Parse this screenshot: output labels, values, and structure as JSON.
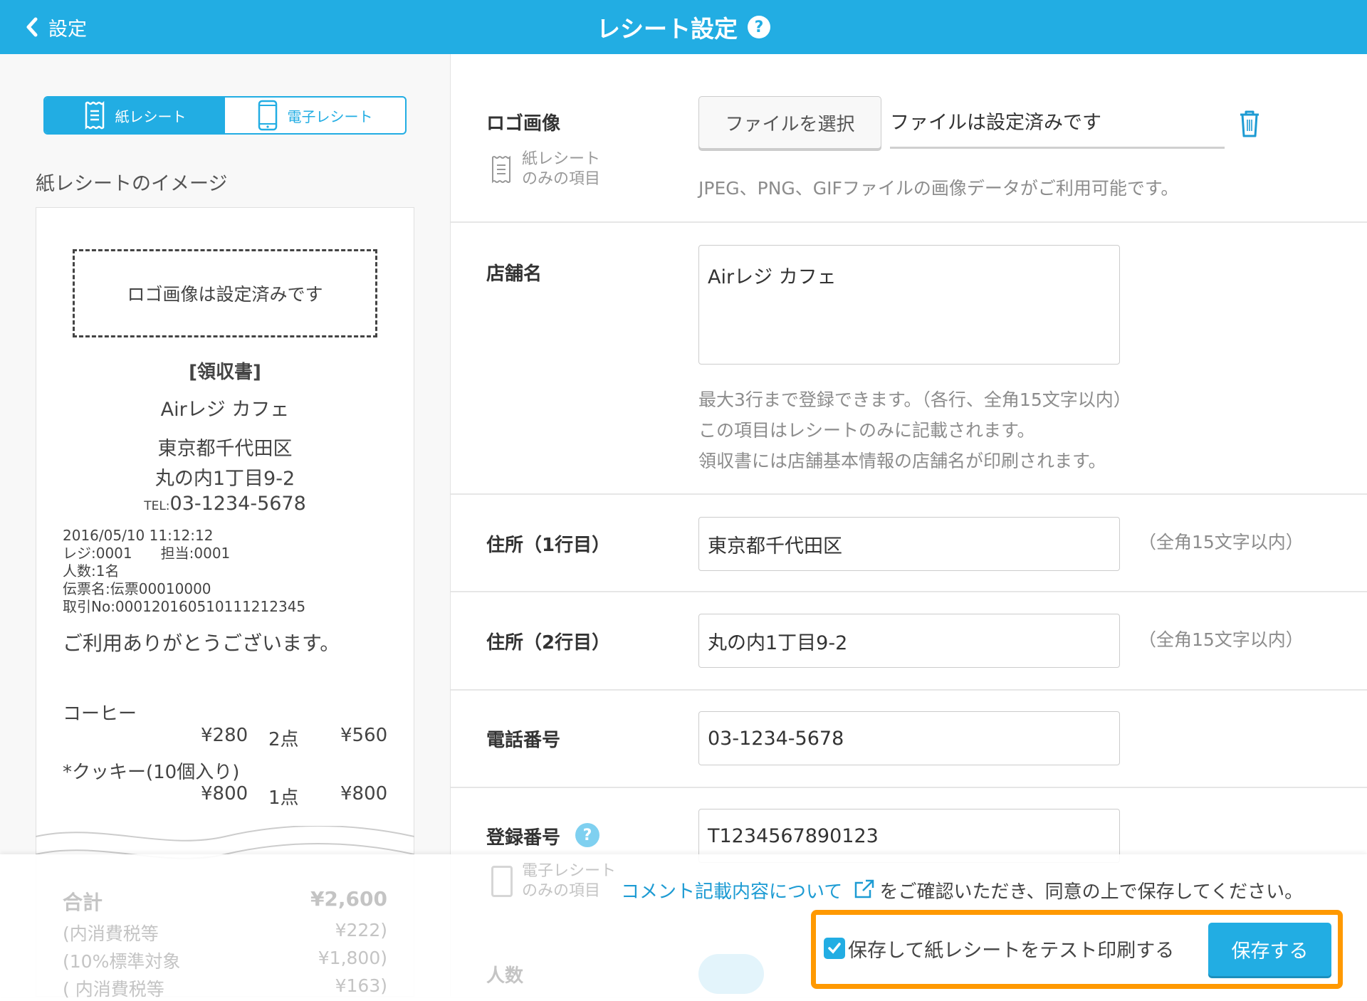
{
  "header": {
    "back_label": "設定",
    "title": "レシート設定",
    "help": "?"
  },
  "left": {
    "tabs": [
      {
        "label": "紙レシート",
        "active": true
      },
      {
        "label": "電子レシート",
        "active": false
      }
    ],
    "preview_title": "紙レシートのイメージ",
    "receipt": {
      "logo_placeholder": "ロゴ画像は設定済みです",
      "heading": "[領収書]",
      "store": "Airレジ カフェ",
      "address1": "東京都千代田区",
      "address2": "丸の内1丁目9-2",
      "tel_prefix": "TEL:",
      "tel": "03-1234-5678",
      "details": [
        "2016/05/10 11:12:12",
        "レジ:0001　　担当:0001",
        "人数:1名",
        "伝票名:伝票00010000",
        "取引No:0001201605101112​12345"
      ],
      "thanks": "ご利用ありがとうございます。",
      "items": [
        {
          "name": "コーヒー",
          "unit": "¥280",
          "qty": "2点",
          "total": "¥560"
        },
        {
          "name": "*クッキー(10個入り)",
          "unit": "¥800",
          "qty": "1点",
          "total": "¥800"
        }
      ],
      "totals": [
        {
          "label": "合計",
          "value": "¥2,600"
        },
        {
          "label": "(内消費税等",
          "value": "¥222)"
        },
        {
          "label": "(10%標準対象",
          "value": "¥1,800)"
        },
        {
          "label": "( 内消費税等",
          "value": "¥163)"
        }
      ]
    }
  },
  "form": {
    "logo": {
      "label": "ロゴ画像",
      "scope": [
        "紙レシート",
        "のみの項目"
      ],
      "button": "ファイルを選択",
      "file_status": "ファイルは設定済みです",
      "hint": "JPEG、PNG、GIFファイルの画像データがご利用可能です。"
    },
    "store": {
      "label": "店舗名",
      "value": "Airレジ カフェ",
      "notes": [
        "最大3行まで登録できます。（各行、全角15文字以内）",
        "この項目はレシートのみに記載されます。",
        "領収書には店舗基本情報の店舗名が印刷されます。"
      ]
    },
    "address1": {
      "label": "住所（1行目）",
      "value": "東京都千代田区",
      "limit": "（全角15文字以内）"
    },
    "address2": {
      "label": "住所（2行目）",
      "value": "丸の内1丁目9-2",
      "limit": "（全角15文字以内）"
    },
    "phone": {
      "label": "電話番号",
      "value": "03-1234-5678"
    },
    "registration": {
      "label": "登録番号",
      "value": "T1234567890123"
    },
    "e_scope": [
      "電子レシート",
      "のみの項目"
    ],
    "people": {
      "label": "人数"
    }
  },
  "footer": {
    "link": "コメント記載内容について",
    "text": "をご確認いただき、同意の上で保存してください。",
    "checkbox_label": "保存して紙レシートをテスト印刷する",
    "checked": true,
    "save": "保存する"
  },
  "colors": {
    "accent": "#22ade3",
    "highlight": "#ff9900"
  }
}
